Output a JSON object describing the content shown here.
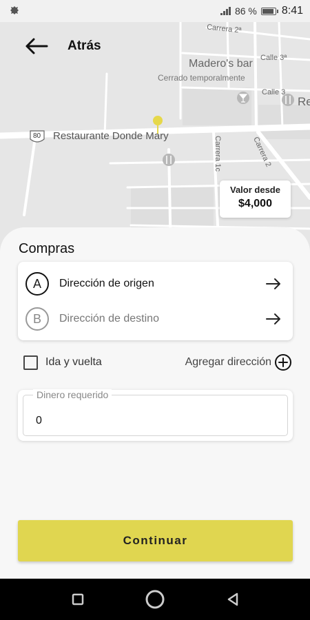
{
  "status_bar": {
    "battery": "86 %",
    "battery_level_percent": 86,
    "time": "8:41"
  },
  "map": {
    "labels": {
      "restaurant": "Restaurante Donde Mary",
      "route_number": "80",
      "bar": "Madero's bar",
      "bar_status": "Cerrado temporalmente",
      "street_carrera2a": "Carrera 2ª",
      "street_calle3a": "Calle 3ª",
      "street_calle3": "Calle 3",
      "street_carrera1c": "Carrera 1c",
      "street_carrera2": "Carrera 2",
      "truncated_place": "Re"
    },
    "pin_color": "#e6d84a"
  },
  "header": {
    "back_label": "Atrás"
  },
  "price": {
    "caption": "Valor desde",
    "value": "$4,000"
  },
  "sheet": {
    "title": "Compras",
    "origin": {
      "badge": "A",
      "label": "Dirección de origen"
    },
    "destination": {
      "badge": "B",
      "label": "Dirección de destino"
    },
    "round_trip_label": "Ida y vuelta",
    "round_trip_checked": false,
    "add_address_label": "Agregar dirección",
    "money": {
      "legend": "Dinero requerido",
      "value": "0"
    },
    "continue_label": "Continuar"
  },
  "colors": {
    "accent": "#e0d650",
    "map_background": "#e6e6e6"
  }
}
